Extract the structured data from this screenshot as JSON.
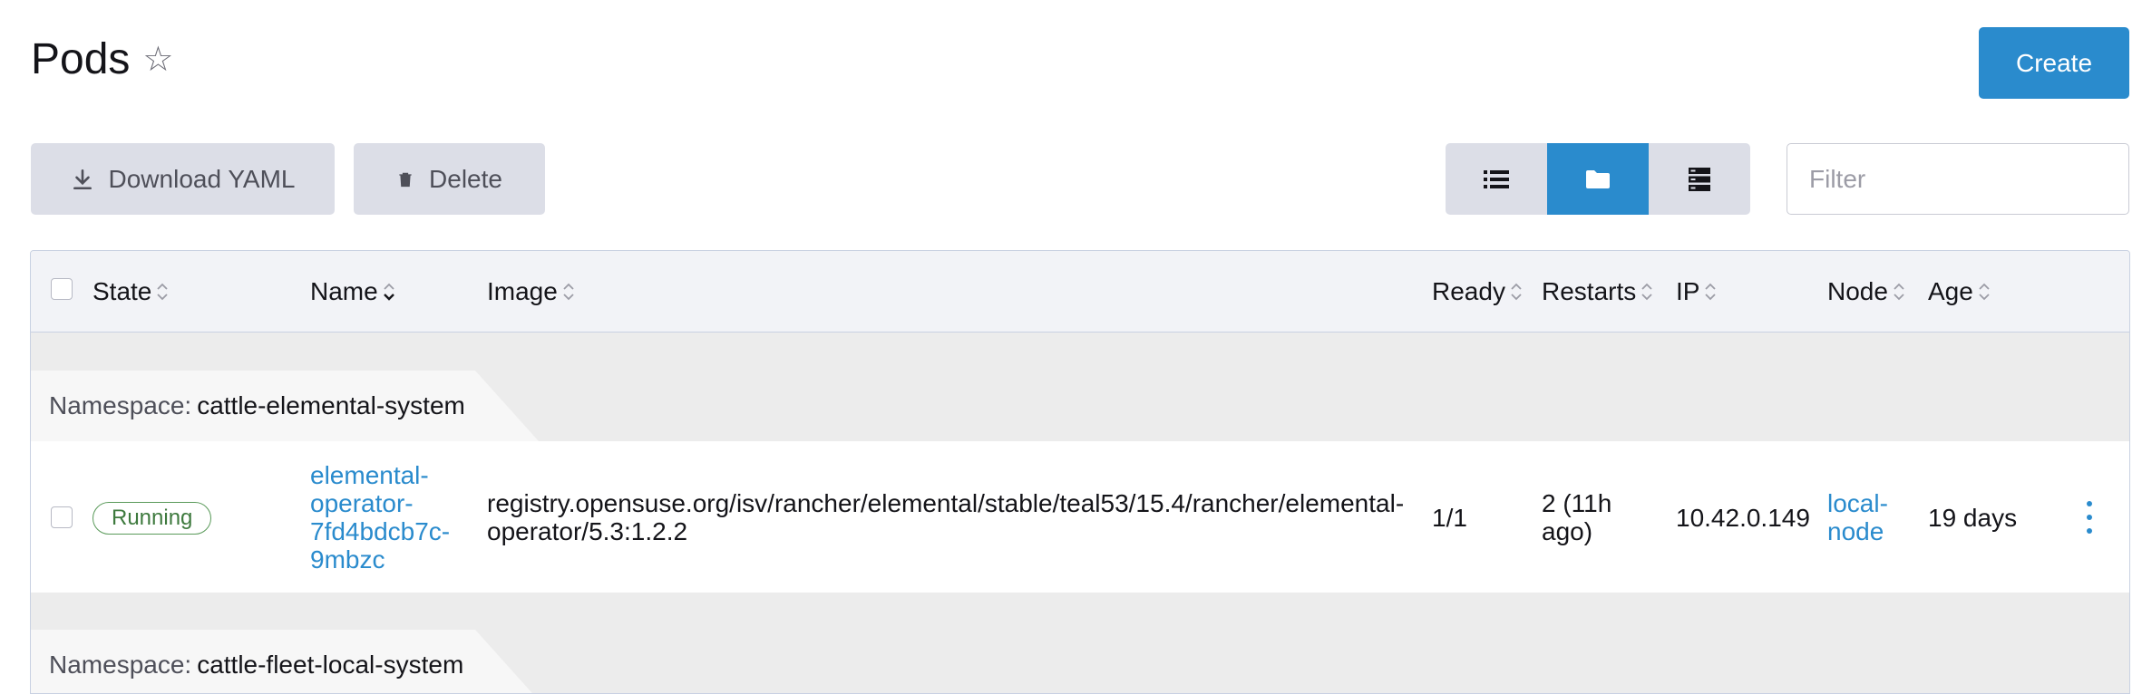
{
  "header": {
    "title": "Pods",
    "create_label": "Create"
  },
  "toolbar": {
    "download_label": "Download YAML",
    "delete_label": "Delete",
    "filter_placeholder": "Filter"
  },
  "table": {
    "columns": {
      "state": "State",
      "name": "Name",
      "image": "Image",
      "ready": "Ready",
      "restarts": "Restarts",
      "ip": "IP",
      "node": "Node",
      "age": "Age"
    },
    "groups": [
      {
        "namespace_label": "Namespace:",
        "namespace": "cattle-elemental-system",
        "rows": [
          {
            "state": "Running",
            "name_lines": [
              "elemental-",
              "operator-",
              "7fd4bdcb7c-",
              "9mbzc"
            ],
            "image_lines": [
              "registry.opensuse.org/isv/rancher/elemental/stable/teal53/15.4/rancher/elemental-",
              "operator/5.3:1.2.2"
            ],
            "ready": "1/1",
            "restarts_lines": [
              "2 (11h",
              "ago)"
            ],
            "ip": "10.42.0.149",
            "node_lines": [
              "local-",
              "node"
            ],
            "age": "19 days"
          }
        ]
      },
      {
        "namespace_label": "Namespace:",
        "namespace": "cattle-fleet-local-system"
      }
    ]
  },
  "colors": {
    "accent": "#2a8bcd",
    "running_green": "#3e7a3e"
  }
}
